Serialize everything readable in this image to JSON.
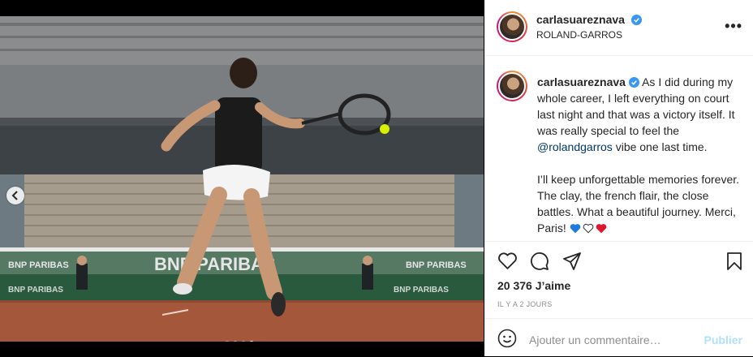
{
  "post": {
    "username": "carlasuareznava",
    "location": "ROLAND-GARROS",
    "caption_part1": "As I did during my whole career, I left everything on court last night and that was a victory itself. It was really special to feel the",
    "mention": "@rolandgarros",
    "caption_part2": "vibe one last time.",
    "caption_part3": "I’ll keep unforgettable memories forever. The clay, the french flair, the close battles. What a beautiful journey. Merci, Paris!",
    "likes": "20 376 J’aime",
    "date": "IL Y A 2 JOURS",
    "carousel_count": 4,
    "carousel_active_index": 3
  },
  "banner_text": {
    "main": "BNP PARIBAS",
    "small": "BNP PARIBAS"
  },
  "comment": {
    "placeholder": "Ajouter un commentaire…",
    "publish_label": "Publier"
  },
  "icons": {
    "more": "more-options-icon",
    "like": "heart-icon",
    "comment": "comment-icon",
    "share": "share-icon",
    "save": "bookmark-icon",
    "emoji": "emoji-icon",
    "verified": "verified-badge-icon",
    "prev": "chevron-left-icon"
  },
  "colors": {
    "verified": "#3897f0",
    "mention": "#00376b",
    "publish": "#b2dffc",
    "clay": "#a4573a"
  }
}
